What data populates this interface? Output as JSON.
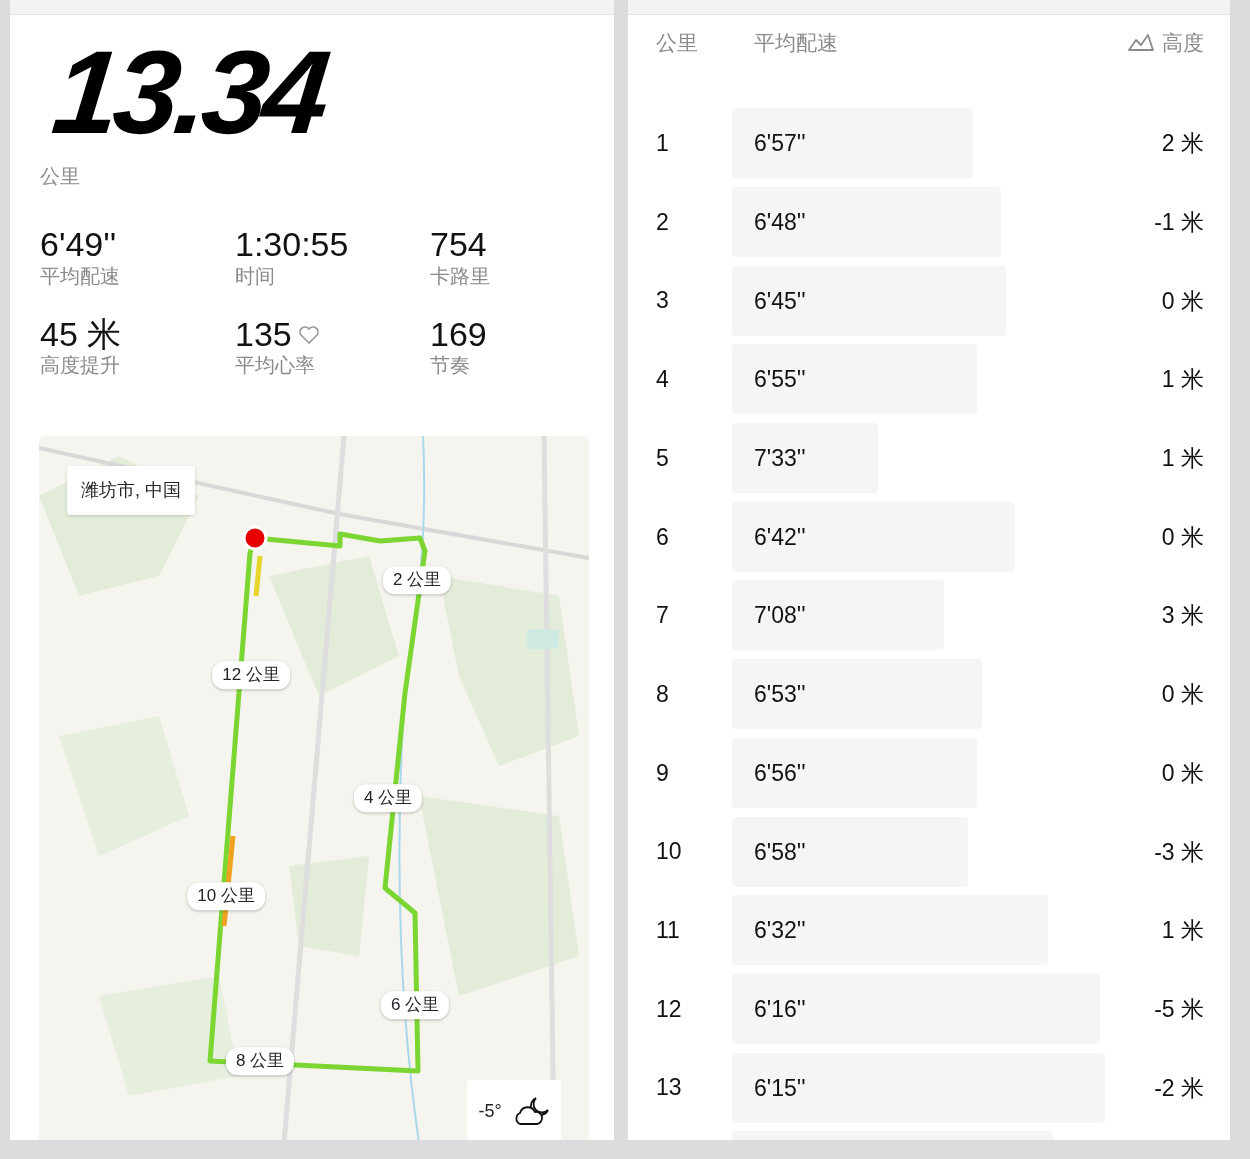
{
  "summary": {
    "distance": "13.34",
    "distance_unit": "公里",
    "stats": [
      {
        "value": "6'49''",
        "label": "平均配速",
        "kind": "plain"
      },
      {
        "value": "1:30:55",
        "label": "时间",
        "kind": "plain"
      },
      {
        "value": "754",
        "label": "卡路里",
        "kind": "plain"
      },
      {
        "value": "45 米",
        "label": "高度提升",
        "kind": "plain"
      },
      {
        "value": "135",
        "label": "平均心率",
        "kind": "heart"
      },
      {
        "value": "169",
        "label": "节奏",
        "kind": "plain"
      }
    ]
  },
  "map": {
    "kind": "picture",
    "location": "潍坊市, 中国",
    "route_labels": [
      "2 公里",
      "12 公里",
      "4 公里",
      "10 公里",
      "6 公里",
      "8 公里"
    ],
    "weather": {
      "temperature": "-5°"
    }
  },
  "splits": {
    "columns": [
      "公里",
      "平均配速",
      "高度"
    ],
    "rows": [
      {
        "km": "1",
        "pace": "6'57''",
        "elevation": "2 米",
        "level": 0.51
      },
      {
        "km": "2",
        "pace": "6'48''",
        "elevation": "-1 米",
        "level": 0.57
      },
      {
        "km": "3",
        "pace": "6'45''",
        "elevation": "0 米",
        "level": 0.58
      },
      {
        "km": "4",
        "pace": "6'55''",
        "elevation": "1 米",
        "level": 0.52
      },
      {
        "km": "5",
        "pace": "7'33''",
        "elevation": "1 米",
        "level": 0.31
      },
      {
        "km": "6",
        "pace": "6'42''",
        "elevation": "0 米",
        "level": 0.6
      },
      {
        "km": "7",
        "pace": "7'08''",
        "elevation": "3 米",
        "level": 0.45
      },
      {
        "km": "8",
        "pace": "6'53''",
        "elevation": "0 米",
        "level": 0.53
      },
      {
        "km": "9",
        "pace": "6'56''",
        "elevation": "0 米",
        "level": 0.52
      },
      {
        "km": "10",
        "pace": "6'58''",
        "elevation": "-3 米",
        "level": 0.5
      },
      {
        "km": "11",
        "pace": "6'32''",
        "elevation": "1 米",
        "level": 0.67
      },
      {
        "km": "12",
        "pace": "6'16''",
        "elevation": "-5 米",
        "level": 0.78
      },
      {
        "km": "13",
        "pace": "6'15''",
        "elevation": "-2 米",
        "level": 0.79
      },
      {
        "level": 0.68
      }
    ]
  }
}
